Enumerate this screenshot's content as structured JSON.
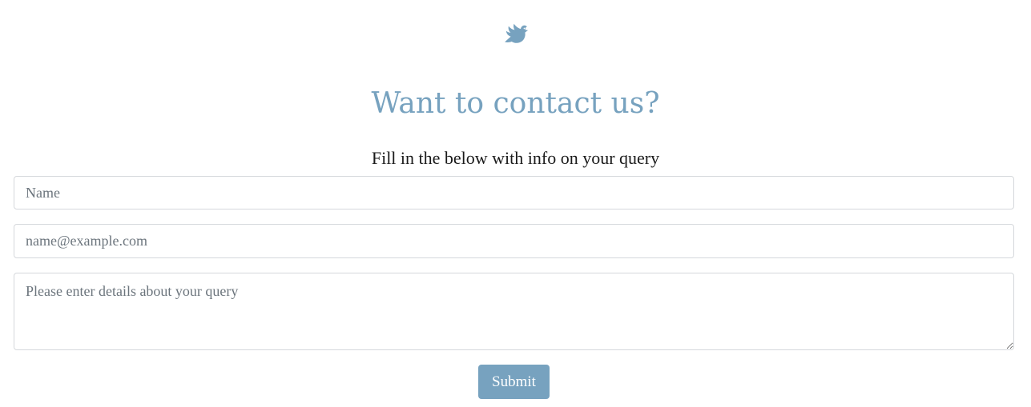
{
  "header": {
    "logo_icon": "dove-icon",
    "title": "Want to contact us?",
    "subtitle": "Fill in the below with info on your query"
  },
  "form": {
    "name_placeholder": "Name",
    "email_placeholder": "name@example.com",
    "query_placeholder": "Please enter details about your query",
    "submit_label": "Submit"
  },
  "colors": {
    "accent": "#77a2bf",
    "text": "#1a1a1a",
    "border": "#d5d8dc",
    "placeholder": "#6c757d"
  }
}
